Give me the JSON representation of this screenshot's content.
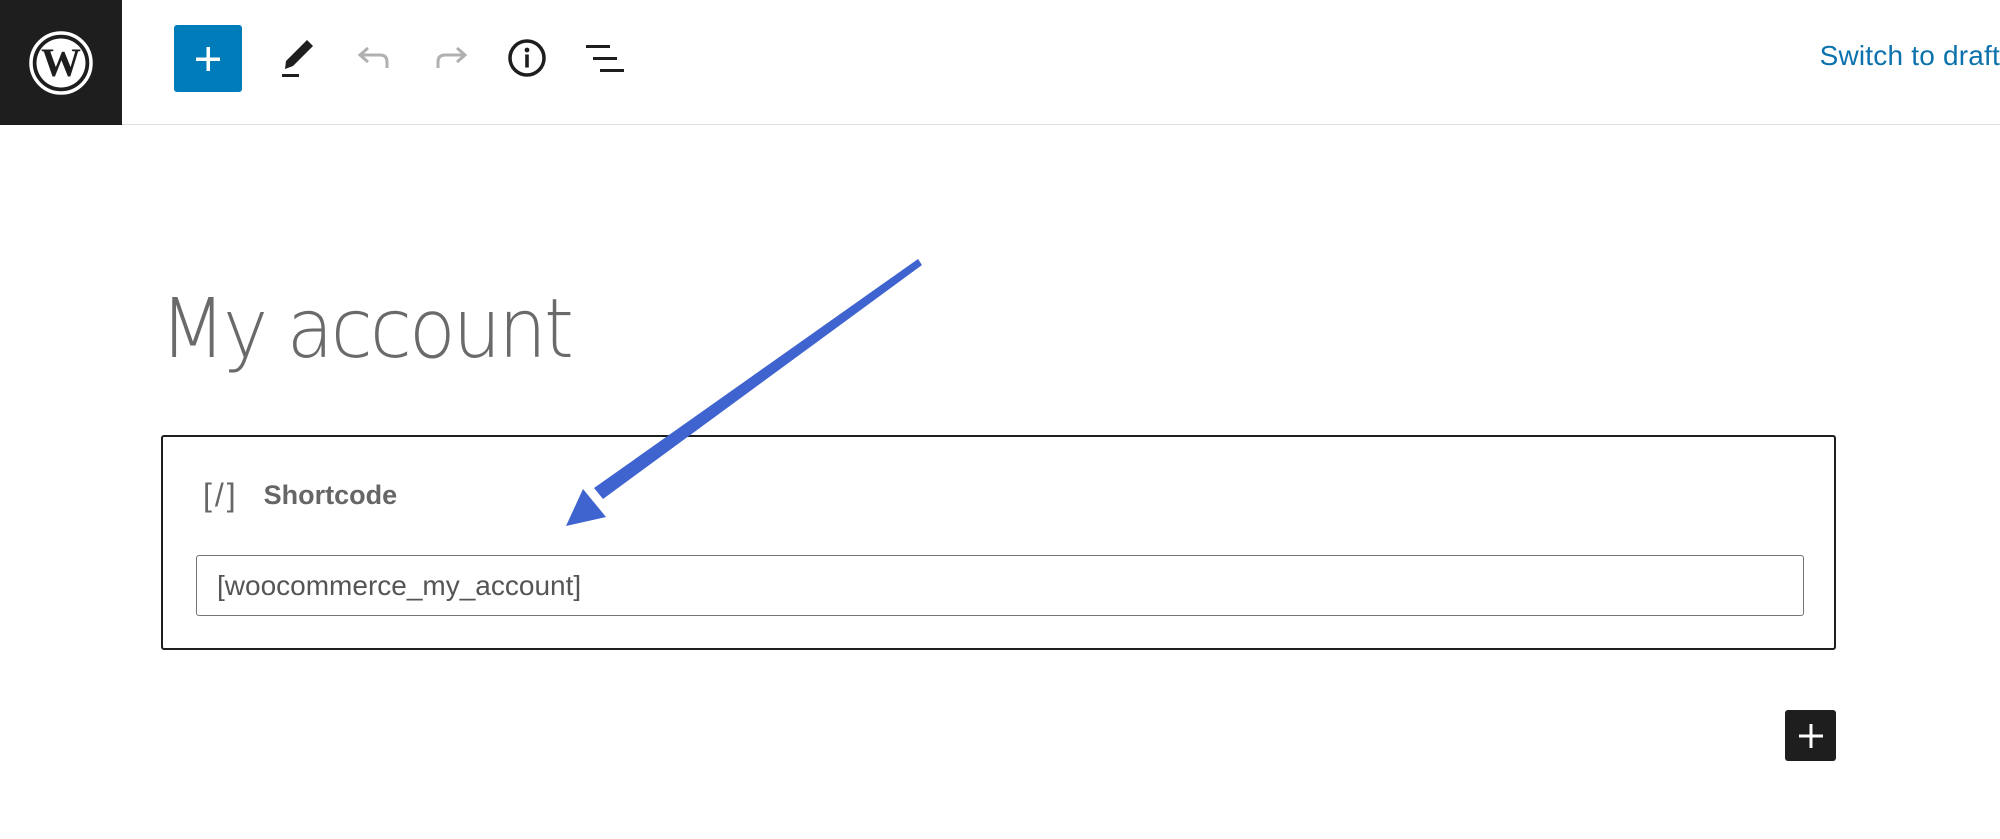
{
  "header": {
    "logo_icon": "wordpress-logo-icon",
    "inserter_icon": "plus-icon",
    "tools": [
      {
        "name": "tools",
        "icon": "pencil-icon"
      },
      {
        "name": "undo",
        "icon": "undo-icon"
      },
      {
        "name": "redo",
        "icon": "redo-icon"
      },
      {
        "name": "details",
        "icon": "info-icon"
      },
      {
        "name": "list-view",
        "icon": "list-view-icon"
      }
    ],
    "switch_to_draft_label": "Switch to draft"
  },
  "editor": {
    "page_title": "My account",
    "block": {
      "icon_text": "[/]",
      "icon": "shortcode-icon",
      "name": "Shortcode",
      "input_value": "[woocommerce_my_account]"
    },
    "add_block_icon": "plus-icon"
  },
  "annotation": {
    "type": "arrow",
    "color": "#3f63cf"
  },
  "colors": {
    "accent": "#007cba",
    "dark": "#1e1e1e",
    "link": "#0b72ad"
  }
}
